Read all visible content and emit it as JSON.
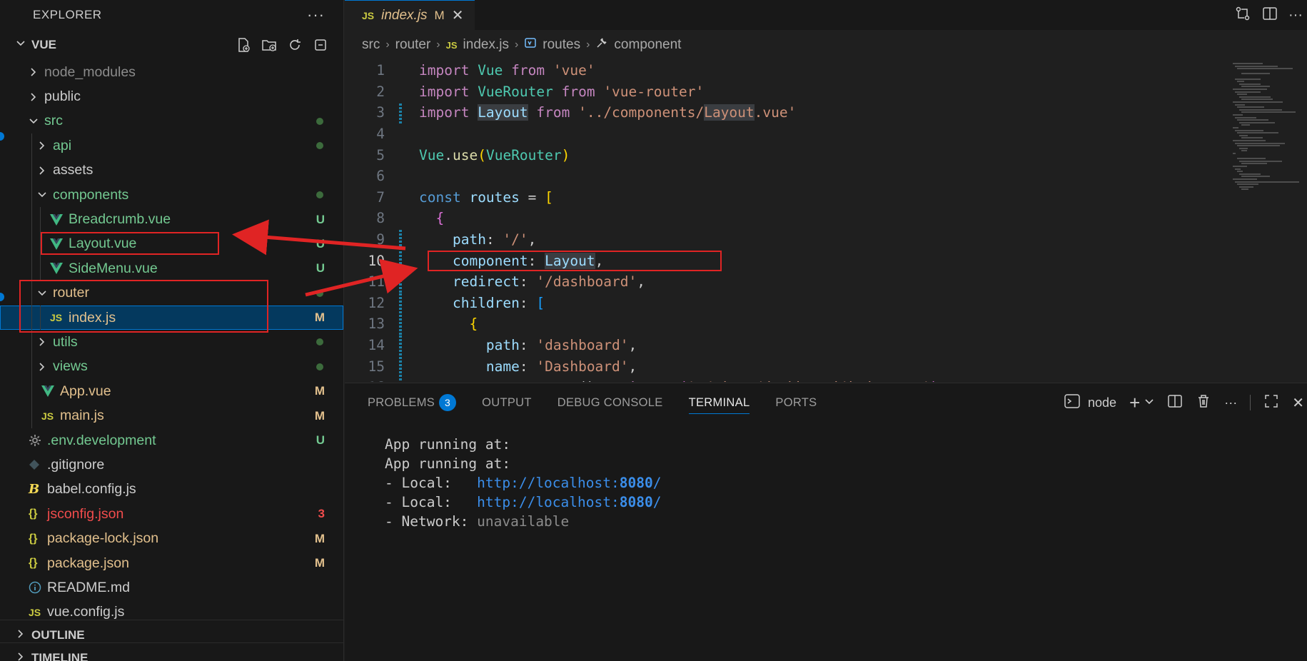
{
  "sidebar": {
    "title": "EXPLORER",
    "more": "···",
    "root": "VUE",
    "tree": [
      {
        "label": "node_modules",
        "kind": "folder",
        "open": false,
        "depth": 0,
        "color": "#8b8b8b"
      },
      {
        "label": "public",
        "kind": "folder",
        "open": false,
        "depth": 0,
        "color": "#cccccc"
      },
      {
        "label": "src",
        "kind": "folder",
        "open": true,
        "depth": 0,
        "color": "#73c991",
        "dot": true
      },
      {
        "label": "api",
        "kind": "folder",
        "open": false,
        "depth": 1,
        "color": "#73c991",
        "dot": true
      },
      {
        "label": "assets",
        "kind": "folder",
        "open": false,
        "depth": 1,
        "color": "#cccccc"
      },
      {
        "label": "components",
        "kind": "folder",
        "open": true,
        "depth": 1,
        "color": "#73c991",
        "dot": true
      },
      {
        "label": "Breadcrumb.vue",
        "kind": "vue",
        "depth": 2,
        "color": "#73c991",
        "badge": "U",
        "badge_color": "#73c991"
      },
      {
        "label": "Layout.vue",
        "kind": "vue",
        "depth": 2,
        "color": "#73c991",
        "badge": "U",
        "badge_color": "#73c991"
      },
      {
        "label": "SideMenu.vue",
        "kind": "vue",
        "depth": 2,
        "color": "#73c991",
        "badge": "U",
        "badge_color": "#73c991"
      },
      {
        "label": "router",
        "kind": "folder",
        "open": true,
        "depth": 1,
        "color": "#e2c08d",
        "dot": true
      },
      {
        "label": "index.js",
        "kind": "js",
        "depth": 2,
        "color": "#e2c08d",
        "badge": "M",
        "badge_color": "#e2c08d",
        "selected": true
      },
      {
        "label": "utils",
        "kind": "folder",
        "open": false,
        "depth": 1,
        "color": "#73c991",
        "dot": true
      },
      {
        "label": "views",
        "kind": "folder",
        "open": false,
        "depth": 1,
        "color": "#73c991",
        "dot": true
      },
      {
        "label": "App.vue",
        "kind": "vue",
        "depth": 1,
        "color": "#e2c08d",
        "badge": "M",
        "badge_color": "#e2c08d"
      },
      {
        "label": "main.js",
        "kind": "js",
        "depth": 1,
        "color": "#e2c08d",
        "badge": "M",
        "badge_color": "#e2c08d"
      },
      {
        "label": ".env.development",
        "kind": "gear",
        "depth": 0,
        "color": "#73c991",
        "badge": "U",
        "badge_color": "#73c991"
      },
      {
        "label": ".gitignore",
        "kind": "git",
        "depth": 0,
        "color": "#cccccc"
      },
      {
        "label": "babel.config.js",
        "kind": "babel",
        "depth": 0,
        "color": "#cccccc"
      },
      {
        "label": "jsconfig.json",
        "kind": "json",
        "depth": 0,
        "color": "#f14c4c",
        "badge": "3",
        "badge_color": "#f14c4c"
      },
      {
        "label": "package-lock.json",
        "kind": "json",
        "depth": 0,
        "color": "#e2c08d",
        "badge": "M",
        "badge_color": "#e2c08d"
      },
      {
        "label": "package.json",
        "kind": "json",
        "depth": 0,
        "color": "#e2c08d",
        "badge": "M",
        "badge_color": "#e2c08d"
      },
      {
        "label": "README.md",
        "kind": "info",
        "depth": 0,
        "color": "#cccccc"
      },
      {
        "label": "vue.config.js",
        "kind": "js",
        "depth": 0,
        "color": "#cccccc"
      }
    ],
    "outline": "OUTLINE",
    "timeline": "TIMELINE"
  },
  "editor": {
    "tab": {
      "icon": "JS",
      "name": "index.js",
      "status": "M",
      "close": "✕"
    },
    "breadcrumb": {
      "p1": "src",
      "p2": "router",
      "p3_icon": "JS",
      "p3": "index.js",
      "p4": "routes",
      "p5": "component"
    },
    "active_line": 10,
    "modified_lines": [
      3,
      9,
      10,
      11,
      12,
      13,
      14,
      15,
      16
    ],
    "lines": [
      [
        [
          "kw-pink",
          "import "
        ],
        [
          "cls",
          "Vue"
        ],
        [
          "kw-pink",
          " from "
        ],
        [
          "str",
          "'vue'"
        ]
      ],
      [
        [
          "kw-pink",
          "import "
        ],
        [
          "cls",
          "VueRouter"
        ],
        [
          "kw-pink",
          " from "
        ],
        [
          "str",
          "'vue-router'"
        ]
      ],
      [
        [
          "kw-pink",
          "import "
        ],
        [
          "var hl",
          "Layout"
        ],
        [
          "kw-pink",
          " from "
        ],
        [
          "str",
          "'../components/"
        ],
        [
          "str hl",
          "Layout"
        ],
        [
          "str",
          ".vue'"
        ]
      ],
      [],
      [
        [
          "cls",
          "Vue"
        ],
        [
          "",
          "."
        ],
        [
          "fn",
          "use"
        ],
        [
          "brk1",
          "("
        ],
        [
          "cls",
          "VueRouter"
        ],
        [
          "brk1",
          ")"
        ]
      ],
      [],
      [
        [
          "kw-blue",
          "const "
        ],
        [
          "var",
          "routes"
        ],
        [
          "",
          " = "
        ],
        [
          "brk1",
          "["
        ]
      ],
      [
        [
          "",
          "  "
        ],
        [
          "brk2",
          "{"
        ]
      ],
      [
        [
          "",
          "    "
        ],
        [
          "var",
          "path"
        ],
        [
          "",
          ": "
        ],
        [
          "str",
          "'/'"
        ],
        [
          "",
          ","
        ]
      ],
      [
        [
          "",
          "    "
        ],
        [
          "var",
          "component"
        ],
        [
          "",
          ": "
        ],
        [
          "var hl",
          "Layout"
        ],
        [
          "",
          ","
        ]
      ],
      [
        [
          "",
          "    "
        ],
        [
          "var",
          "redirect"
        ],
        [
          "",
          ": "
        ],
        [
          "str",
          "'/dashboard'"
        ],
        [
          "",
          ","
        ]
      ],
      [
        [
          "",
          "    "
        ],
        [
          "var",
          "children"
        ],
        [
          "",
          ": "
        ],
        [
          "brk3",
          "["
        ]
      ],
      [
        [
          "",
          "      "
        ],
        [
          "brk1",
          "{"
        ]
      ],
      [
        [
          "",
          "        "
        ],
        [
          "var",
          "path"
        ],
        [
          "",
          ": "
        ],
        [
          "str",
          "'dashboard'"
        ],
        [
          "",
          ","
        ]
      ],
      [
        [
          "",
          "        "
        ],
        [
          "var",
          "name"
        ],
        [
          "",
          ": "
        ],
        [
          "str",
          "'Dashboard'"
        ],
        [
          "",
          ","
        ]
      ],
      [
        [
          "",
          "        "
        ],
        [
          "var",
          "component"
        ],
        [
          "",
          ": () => "
        ],
        [
          "kw-pink",
          "import"
        ],
        [
          "brk2",
          "("
        ],
        [
          "str",
          "'@/views/dashboard/index.vue'"
        ],
        [
          "brk2",
          ")"
        ]
      ]
    ]
  },
  "panel": {
    "tabs": [
      {
        "label": "PROBLEMS",
        "count": "3"
      },
      {
        "label": "OUTPUT"
      },
      {
        "label": "DEBUG CONSOLE"
      },
      {
        "label": "TERMINAL",
        "active": true
      },
      {
        "label": "PORTS"
      }
    ],
    "terminal_name": "node",
    "terminal": [
      [
        [
          "",
          "App running at:"
        ]
      ],
      [
        [
          "",
          "App running at:"
        ]
      ],
      [
        [
          "",
          "- Local:   "
        ],
        [
          "t-link",
          "http://localhost:"
        ],
        [
          "t-bold",
          "8080"
        ],
        [
          "t-link",
          "/"
        ]
      ],
      [
        [
          "",
          "- Local:   "
        ],
        [
          "t-link",
          "http://localhost:"
        ],
        [
          "t-bold",
          "8080"
        ],
        [
          "t-link",
          "/"
        ]
      ],
      [
        [
          "",
          "- Network: "
        ],
        [
          "t-dim",
          "unavailable"
        ]
      ]
    ]
  },
  "colors": {
    "accent": "#0078d4",
    "annotation": "#e02424"
  }
}
